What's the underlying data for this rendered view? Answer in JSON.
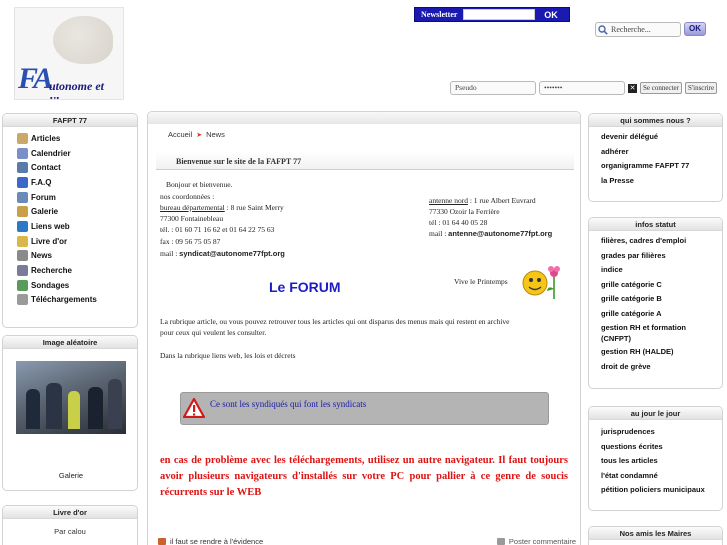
{
  "logo": {
    "letters_f": "F",
    "letters_a": "A",
    "tagline": "utonome et libre"
  },
  "newsletter": {
    "label": "Newsletter",
    "button": "OK"
  },
  "search": {
    "placeholder": "Recherche...",
    "button": "OK"
  },
  "login": {
    "username_placeholder": "Pseudo",
    "password_mask": "•••••••",
    "connect_button": "Se connecter",
    "register_button": "S'inscrire"
  },
  "left_menu": {
    "title": "FAFPT 77",
    "items": [
      {
        "label": "Articles",
        "icon": "articles-icon",
        "color": "#c9a86a"
      },
      {
        "label": "Calendrier",
        "icon": "calendar-icon",
        "color": "#7a8fc8"
      },
      {
        "label": "Contact",
        "icon": "contact-icon",
        "color": "#5a7aa8"
      },
      {
        "label": "F.A.Q",
        "icon": "faq-icon",
        "color": "#3a6ac8"
      },
      {
        "label": "Forum",
        "icon": "forum-icon",
        "color": "#6a8ab8"
      },
      {
        "label": "Galerie",
        "icon": "gallery-icon",
        "color": "#c8a04a"
      },
      {
        "label": "Liens web",
        "icon": "globe-icon",
        "color": "#2a78c8"
      },
      {
        "label": "Livre d'or",
        "icon": "guestbook-icon",
        "color": "#d8b84a"
      },
      {
        "label": "News",
        "icon": "news-icon",
        "color": "#8a8a8a"
      },
      {
        "label": "Recherche",
        "icon": "search-icon",
        "color": "#7a7a9a"
      },
      {
        "label": "Sondages",
        "icon": "poll-icon",
        "color": "#5a9a5a"
      },
      {
        "label": "Téléchargements",
        "icon": "download-icon",
        "color": "#9a9a9a"
      }
    ]
  },
  "random_image": {
    "title": "Image aléatoire",
    "link": "Galerie"
  },
  "guestbook": {
    "title": "Livre d'or",
    "author": "Par calou"
  },
  "breadcrumb": {
    "home": "Accueil",
    "current": "News"
  },
  "welcome_title": "Bienvenue sur le site de la FAFPT 77",
  "content": {
    "greeting": "Bonjour et bienvenue.",
    "coords_intro": "nos coordonnées :",
    "bureau_link": "bureau départemental",
    "bureau_address": " : 8 rue Saint Merry",
    "city": "77300 Fontainebleau",
    "tel": "tél. : 01 60 71 16 62 et 01 64 22 75 63",
    "fax": "fax : 09 56 75 05 87",
    "mail_label": "mail : ",
    "mail": "syndicat@autonome77fpt.org",
    "nord_link": "antenne nord",
    "nord_address": " : 1 rue Albert Euvrard",
    "nord_city": "77330 Ozoir la Ferrière",
    "nord_tel": "tél : 01 64 40 05 28",
    "nord_mail_label": "mail : ",
    "nord_mail": "antenne@autonome77fpt.org",
    "forum_title": "Le FORUM",
    "spring": "Vive le Printemps",
    "rubrique1": "La rubrique article, ou vous pouvez retrouver tous les articles qui ont disparus des menus mais qui restent en archive",
    "rubrique2": "pour ceux qui veulent les consulter.",
    "rubrique3": "Dans la rubrique liens web, les lois et décrets",
    "warning": "Ce sont les syndiqués qui font les syndicats",
    "red_notice": "en cas de problème avec les téléchargements, utilisez un autre navigateur. Il faut toujours avoir plusieurs navigateurs d'installés sur votre PC pour pallier à ce genre de soucis récurrents sur le WEB",
    "bottom_left": "il faut se rendre à l'évidence",
    "bottom_right": "Poster commentaire"
  },
  "who_panel": {
    "title": "qui sommes nous ?",
    "items": [
      "devenir délégué",
      "adhérer",
      "organigramme FAFPT 77",
      "la Presse"
    ]
  },
  "info_panel": {
    "title": "infos statut",
    "items": [
      "filières, cadres d'emploi",
      "grades par filières",
      "indice",
      "grille catégorie C",
      "grille catégorie B",
      "grille catégorie A",
      "gestion RH et formation (CNFPT)",
      "gestion RH (HALDE)",
      "droit de grève"
    ]
  },
  "day_panel": {
    "title": "au jour le jour",
    "items": [
      "jurisprudences",
      "questions écrites",
      "tous les articles",
      "l'état condamné",
      "pétition policiers municipaux"
    ]
  },
  "mayors_panel": {
    "title": "Nos amis les Maires"
  }
}
